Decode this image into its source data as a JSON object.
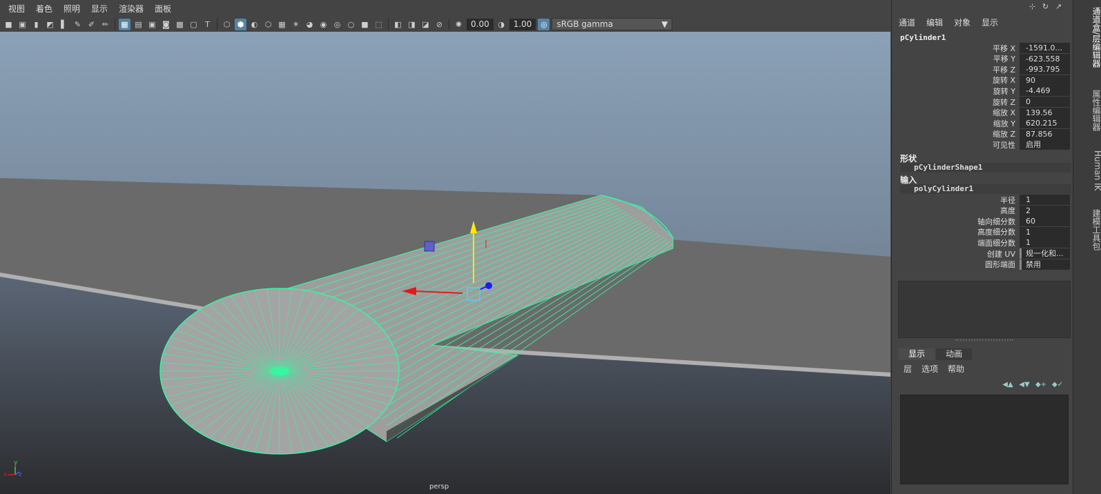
{
  "viewport": {
    "menus": [
      "视图",
      "着色",
      "照明",
      "显示",
      "渲染器",
      "面板"
    ],
    "toolbar": {
      "exposure": "0.00",
      "gamma": "1.00",
      "color_space": "sRGB gamma"
    },
    "camera_label": "persp",
    "axis": {
      "x": "x",
      "y": "y",
      "z": "z"
    }
  },
  "channel_box": {
    "menus": [
      "通道",
      "编辑",
      "对象",
      "显示"
    ],
    "object_name": "pCylinder1",
    "transform_attrs": [
      {
        "label": "平移 X",
        "value": "-1591.0..."
      },
      {
        "label": "平移 Y",
        "value": "-623.558"
      },
      {
        "label": "平移 Z",
        "value": "-993.795"
      },
      {
        "label": "旋转 X",
        "value": "90"
      },
      {
        "label": "旋转 Y",
        "value": "-4.469"
      },
      {
        "label": "旋转 Z",
        "value": "0"
      },
      {
        "label": "缩放 X",
        "value": "139.56"
      },
      {
        "label": "缩放 Y",
        "value": "620.215"
      },
      {
        "label": "缩放 Z",
        "value": "87.856"
      },
      {
        "label": "可见性",
        "value": "启用"
      }
    ],
    "shapes_title": "形状",
    "shape_name": "pCylinderShape1",
    "inputs_title": "输入",
    "input_name": "polyCylinder1",
    "input_attrs": [
      {
        "label": "半径",
        "value": "1"
      },
      {
        "label": "高度",
        "value": "2"
      },
      {
        "label": "轴向细分数",
        "value": "60"
      },
      {
        "label": "高度细分数",
        "value": "1"
      },
      {
        "label": "端面细分数",
        "value": "1"
      },
      {
        "label": "创建 UV",
        "value": "规一化和..."
      },
      {
        "label": "圆形端面",
        "value": "禁用"
      }
    ]
  },
  "layer_editor": {
    "tabs": [
      "显示",
      "动画"
    ],
    "menus": [
      "层",
      "选项",
      "帮助"
    ]
  },
  "side_tabs": [
    "通道盒/层编辑器",
    "属性编辑器",
    "Human IK",
    "建模工具包"
  ],
  "colors": {
    "wire": "#38f5a0",
    "sky_top": "#8ba1b7",
    "sky_bottom": "#5d6878",
    "ground": "#6a6a6a",
    "mesh": "#9e9e9e",
    "panel": "#444444"
  }
}
